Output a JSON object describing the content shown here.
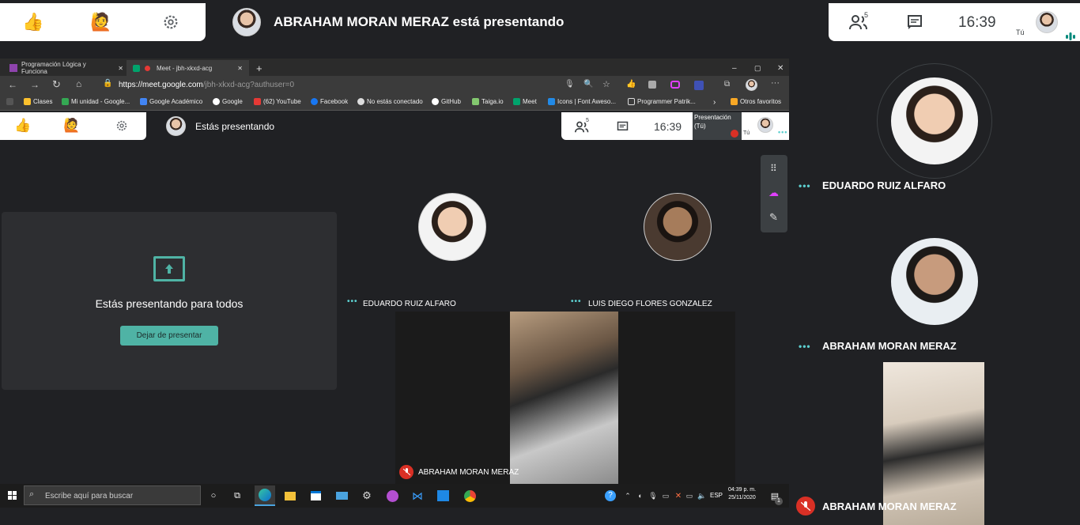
{
  "outer": {
    "presenter_banner": "ABRAHAM MORAN MERAZ está presentando",
    "participants_count": "5",
    "clock": "16:39",
    "you_label": "Tú",
    "icons": [
      "thumbs-up-icon",
      "raise-hand-icon",
      "gear-icon",
      "people-icon",
      "chat-icon"
    ]
  },
  "browser": {
    "tabs": [
      {
        "label": "Programación Lógica y Funciona"
      },
      {
        "label": "Meet - jbh-xkxd-acg"
      }
    ],
    "url_main": "https://meet.google.com",
    "url_rest": "/jbh-xkxd-acg?authuser=0",
    "bookmarks": [
      "Clases",
      "Mi unidad - Google...",
      "Google Académico",
      "Google",
      "(62) YouTube",
      "Facebook",
      "No estás conectado",
      "GitHub",
      "Taiga.io",
      "Meet",
      "Icons | Font Aweso...",
      "Programmer Patrik...",
      "Otros favoritos"
    ]
  },
  "inner": {
    "presenter_banner": "Estás presentando",
    "participants_count": "5",
    "clock": "16:39",
    "presentation_label_1": "Presentación",
    "presentation_label_2": "(Tú)",
    "you_label": "Tú",
    "presenting_message": "Estás presentando para todos",
    "stop_button": "Dejar de presentar",
    "tiles": [
      {
        "name": "EDUARDO RUIZ ALFARO"
      },
      {
        "name": "LUIS DIEGO FLORES GONZALEZ"
      },
      {
        "name": "ABRAHAM MORAN MERAZ"
      }
    ]
  },
  "taskbar": {
    "search_placeholder": "Escribe aquí para buscar",
    "lang": "ESP",
    "time": "04:39 p. m.",
    "date": "25/11/2020",
    "notif_badge": "1"
  },
  "side": {
    "participants": [
      {
        "name": "EDUARDO RUIZ ALFARO"
      },
      {
        "name": "ABRAHAM MORAN MERAZ"
      },
      {
        "name": "ABRAHAM MORAN MERAZ"
      }
    ]
  },
  "colors": {
    "accent": "#00897b",
    "teal_dots": "#5ccfcf",
    "mic_red": "#d93025",
    "dark_bg": "#202124"
  }
}
